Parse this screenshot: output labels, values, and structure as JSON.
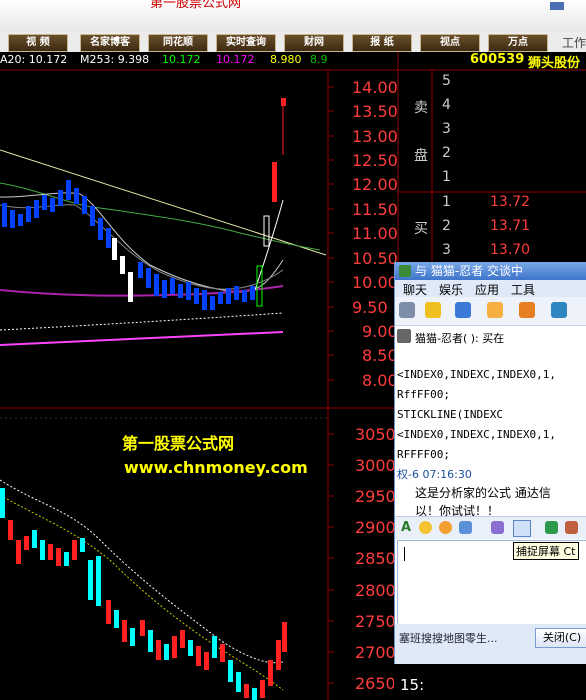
{
  "window": {
    "title": "第一股票公式网"
  },
  "menu": {
    "items": [
      "视 频",
      "名家博客",
      "同花顺",
      "实时查询",
      "财网",
      "报 纸",
      "视点",
      "万点",
      "工作"
    ]
  },
  "indicator_line": {
    "items": [
      {
        "text": "A20: 10.172",
        "color": "#ffffff"
      },
      {
        "text": "M253: 9.398",
        "color": "#ffffff"
      },
      {
        "text": "10.172",
        "color": "#00ff00"
      },
      {
        "text": "10.172",
        "color": "#ff00ff"
      },
      {
        "text": "8.980",
        "color": "#ffff00"
      },
      {
        "text": "8.9",
        "color": "#00c000"
      }
    ]
  },
  "stock": {
    "code": "600539",
    "name": "狮头股份"
  },
  "axis_upper": [
    "14.00",
    "13.50",
    "13.00",
    "12.50",
    "12.00",
    "11.50",
    "11.00",
    "10.50",
    "10.00",
    "9.50",
    "9.00",
    "8.50",
    "8.00"
  ],
  "axis_lower": [
    "3050",
    "3000",
    "2950",
    "2900",
    "2850",
    "2800",
    "2750",
    "2700",
    "2650"
  ],
  "order_book": {
    "sell_label_1": "卖",
    "sell_label_2": "盘",
    "sell_levels": [
      "5",
      "4",
      "3",
      "2",
      "1"
    ],
    "buy_label": "买",
    "buy_levels": [
      {
        "level": "1",
        "price": "13.72"
      },
      {
        "level": "2",
        "price": "13.71"
      },
      {
        "level": "3",
        "price": "13.70"
      }
    ]
  },
  "watermark": {
    "line1": "第一股票公式网",
    "line2": "www.chnmoney.com"
  },
  "chat": {
    "title": "与 猫猫-忍者 交谈中",
    "tabs": [
      "聊天",
      "娱乐",
      "应用",
      "工具"
    ],
    "sender_line": "猫猫-忍者(           ): 买在",
    "lines": [
      "<INDEX0,INDEXC,INDEX0,1,",
      "RffFF00;",
      "STICKLINE(INDEXC",
      "<INDEX0,INDEXC,INDEX0,1,",
      "RFFFF00;"
    ],
    "reply_header": "权-6 07:16:30",
    "reply_lines": [
      "这是分析家的公式 通达信",
      "以！你试试！！"
    ],
    "tooltip": "捕捉屏幕 Ct",
    "footer_text": "塞班搜搜地图零生...",
    "close_label": "关闭(C)"
  },
  "bottom": {
    "time": "15:"
  }
}
